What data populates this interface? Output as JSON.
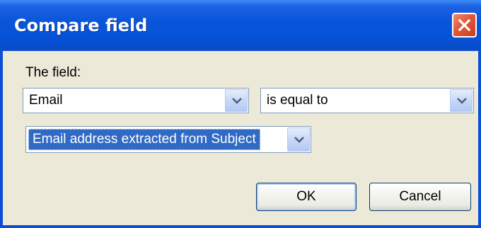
{
  "window": {
    "title": "Compare field"
  },
  "form": {
    "field_label": "The field:",
    "field_select": {
      "value": "Email"
    },
    "operator_select": {
      "value": "is equal to"
    },
    "source_select": {
      "value": "Email address extracted from Subject"
    }
  },
  "buttons": {
    "ok_label": "OK",
    "cancel_label": "Cancel"
  },
  "colors": {
    "titlebar": "#0a56db",
    "dialog_bg": "#ece9d8",
    "selection": "#316ac5",
    "close_button": "#e2573a"
  },
  "icons": {
    "close": "close-icon",
    "dropdown": "chevron-down-icon"
  }
}
